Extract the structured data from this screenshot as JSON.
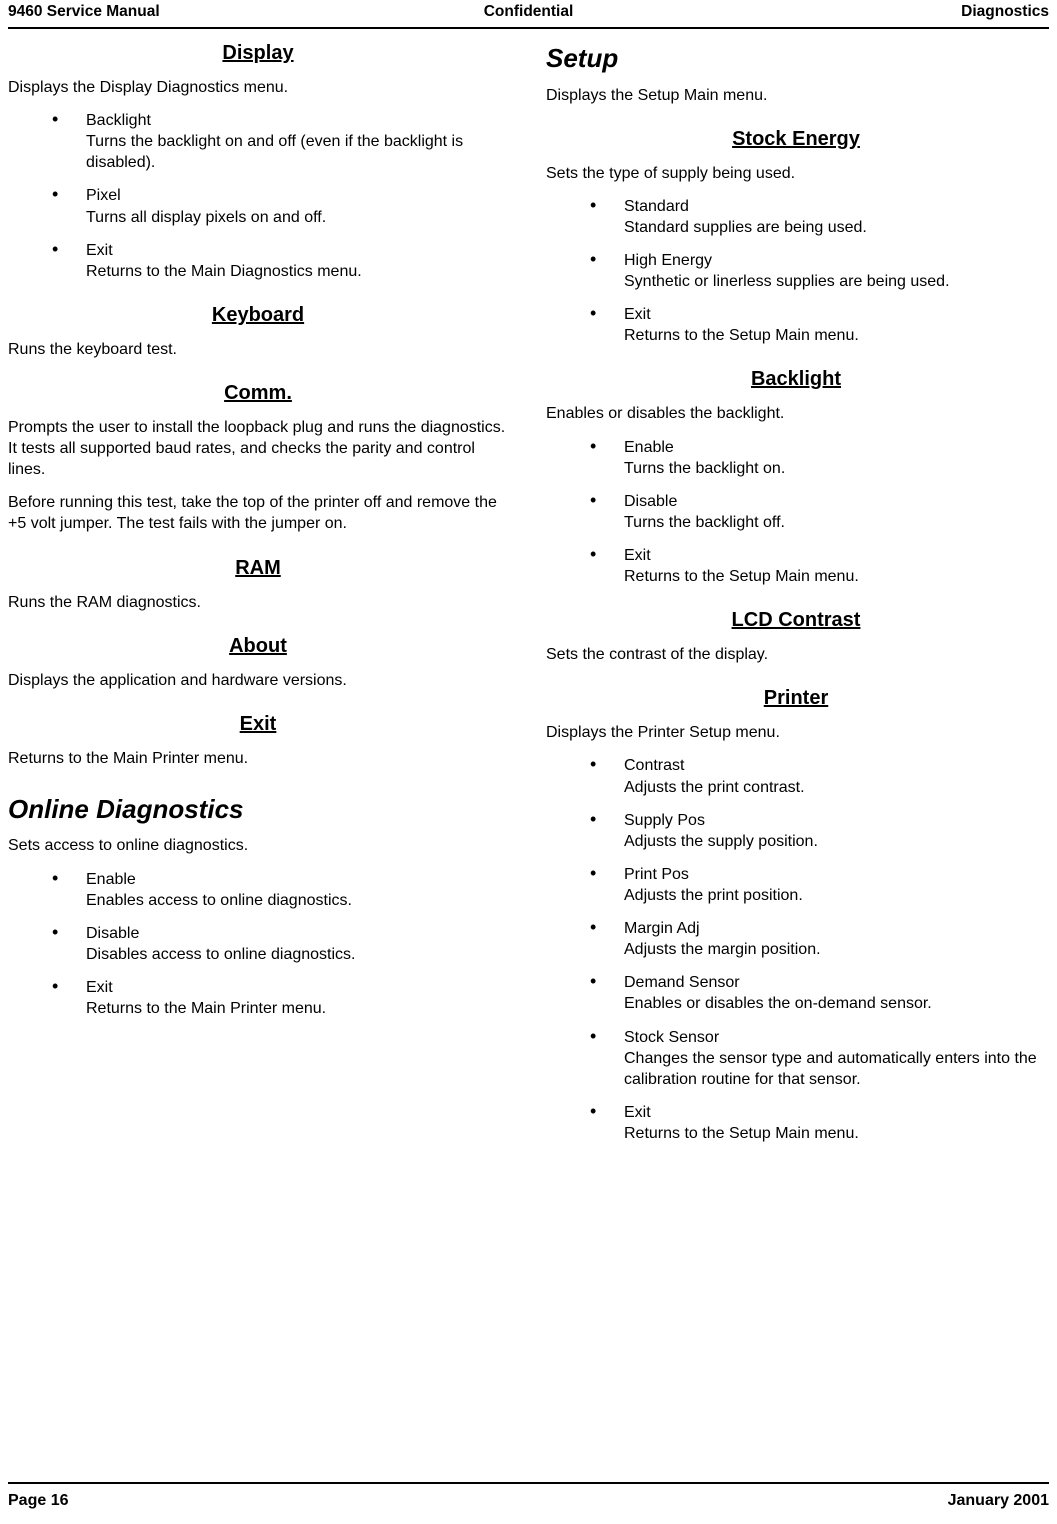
{
  "header": {
    "left": "9460 Service Manual",
    "center": "Confidential",
    "right": "Diagnostics"
  },
  "footer": {
    "left": "Page 16",
    "right": "January 2001"
  },
  "left_column": {
    "sections": [
      {
        "heading": "Display",
        "heading_style": "centered-underline",
        "paragraphs": [
          "Displays the Display Diagnostics menu."
        ],
        "bullets": [
          {
            "term": "Backlight",
            "desc": "Turns the backlight on and off (even if the backlight is disabled)."
          },
          {
            "term": "Pixel",
            "desc": "Turns all display pixels on and off."
          },
          {
            "term": "Exit",
            "desc": "Returns to the Main Diagnostics menu."
          }
        ]
      },
      {
        "heading": "Keyboard",
        "heading_style": "centered-underline",
        "paragraphs": [
          "Runs the keyboard test."
        ],
        "bullets": []
      },
      {
        "heading": "Comm.",
        "heading_style": "centered-underline",
        "paragraphs": [
          "Prompts the user to install the loopback plug and runs the diagnostics.  It tests all supported baud rates, and checks the parity and control lines.",
          "Before running this test, take the top of the printer off and remove the +5 volt jumper.  The test fails with the jumper on."
        ],
        "bullets": []
      },
      {
        "heading": "RAM",
        "heading_style": "centered-underline",
        "paragraphs": [
          "Runs the RAM diagnostics."
        ],
        "bullets": []
      },
      {
        "heading": "About",
        "heading_style": "centered-underline",
        "paragraphs": [
          "Displays the application and hardware versions."
        ],
        "bullets": []
      },
      {
        "heading": "Exit",
        "heading_style": "centered-underline",
        "paragraphs": [
          "Returns to the Main Printer menu."
        ],
        "bullets": []
      },
      {
        "heading": "Online Diagnostics",
        "heading_style": "large-italic",
        "paragraphs": [
          "Sets access to online diagnostics."
        ],
        "bullets": [
          {
            "term": "Enable",
            "desc": "Enables access to online diagnostics."
          },
          {
            "term": "Disable",
            "desc": "Disables access to online diagnostics."
          },
          {
            "term": "Exit",
            "desc": "Returns to the Main Printer menu."
          }
        ]
      }
    ]
  },
  "right_column": {
    "sections": [
      {
        "heading": "Setup",
        "heading_style": "large-italic",
        "paragraphs": [
          "Displays the Setup Main menu."
        ],
        "bullets": []
      },
      {
        "heading": "Stock Energy",
        "heading_style": "centered-underline",
        "paragraphs": [
          "Sets the type of supply being used."
        ],
        "bullets": [
          {
            "term": "Standard",
            "desc": "Standard supplies are being used."
          },
          {
            "term": "High Energy",
            "desc": "Synthetic or linerless supplies are being used."
          },
          {
            "term": "Exit",
            "desc": "Returns to the Setup Main menu."
          }
        ]
      },
      {
        "heading": "Backlight",
        "heading_style": "centered-underline",
        "paragraphs": [
          "Enables or disables the backlight."
        ],
        "bullets": [
          {
            "term": "Enable",
            "desc": "Turns the backlight on."
          },
          {
            "term": "Disable",
            "desc": "Turns the backlight off."
          },
          {
            "term": "Exit",
            "desc": "Returns to the Setup Main menu."
          }
        ]
      },
      {
        "heading": "LCD Contrast",
        "heading_style": "centered-underline",
        "paragraphs": [
          "Sets the contrast of the display."
        ],
        "bullets": []
      },
      {
        "heading": "Printer",
        "heading_style": "centered-underline",
        "paragraphs": [
          "Displays the Printer Setup menu."
        ],
        "bullets": [
          {
            "term": "Contrast",
            "desc": "Adjusts the print contrast."
          },
          {
            "term": "Supply Pos",
            "desc": "Adjusts the supply position."
          },
          {
            "term": "Print Pos",
            "desc": "Adjusts the print position."
          },
          {
            "term": "Margin Adj",
            "desc": "Adjusts the margin position."
          },
          {
            "term": "Demand Sensor",
            "desc": "Enables or disables the on-demand sensor."
          },
          {
            "term": "Stock Sensor",
            "desc": "Changes the sensor type and automatically enters into the calibration routine for that sensor."
          },
          {
            "term": "Exit",
            "desc": "Returns to the Setup Main menu."
          }
        ]
      }
    ]
  },
  "bullet_glyph": "•"
}
